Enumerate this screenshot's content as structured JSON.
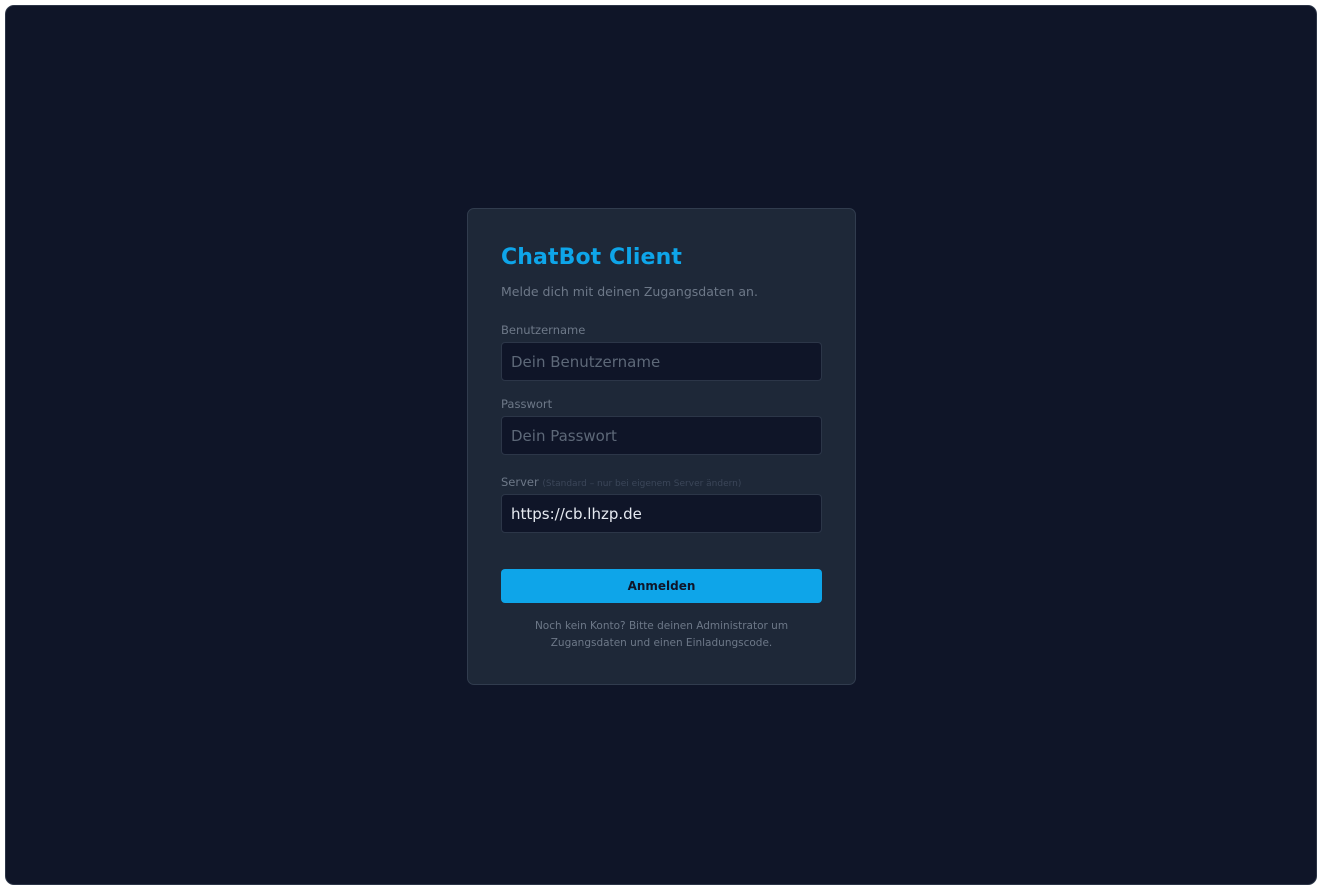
{
  "login": {
    "title": "ChatBot Client",
    "subtitle": "Melde dich mit deinen Zugangsdaten an.",
    "username": {
      "label": "Benutzername",
      "placeholder": "Dein Benutzername",
      "value": ""
    },
    "password": {
      "label": "Passwort",
      "placeholder": "Dein Passwort",
      "value": ""
    },
    "server": {
      "label": "Server",
      "hint": "(Standard – nur bei eigenem Server ändern)",
      "value": "https://cb.lhzp.de"
    },
    "submit_label": "Anmelden",
    "footer_line1": "Noch kein Konto? Bitte deinen Administrator um",
    "footer_line2": "Zugangsdaten und einen Einladungscode."
  },
  "colors": {
    "background": "#0f1528",
    "card": "#1e2838",
    "accent": "#0ea5e9",
    "muted_text": "#6d7888"
  }
}
